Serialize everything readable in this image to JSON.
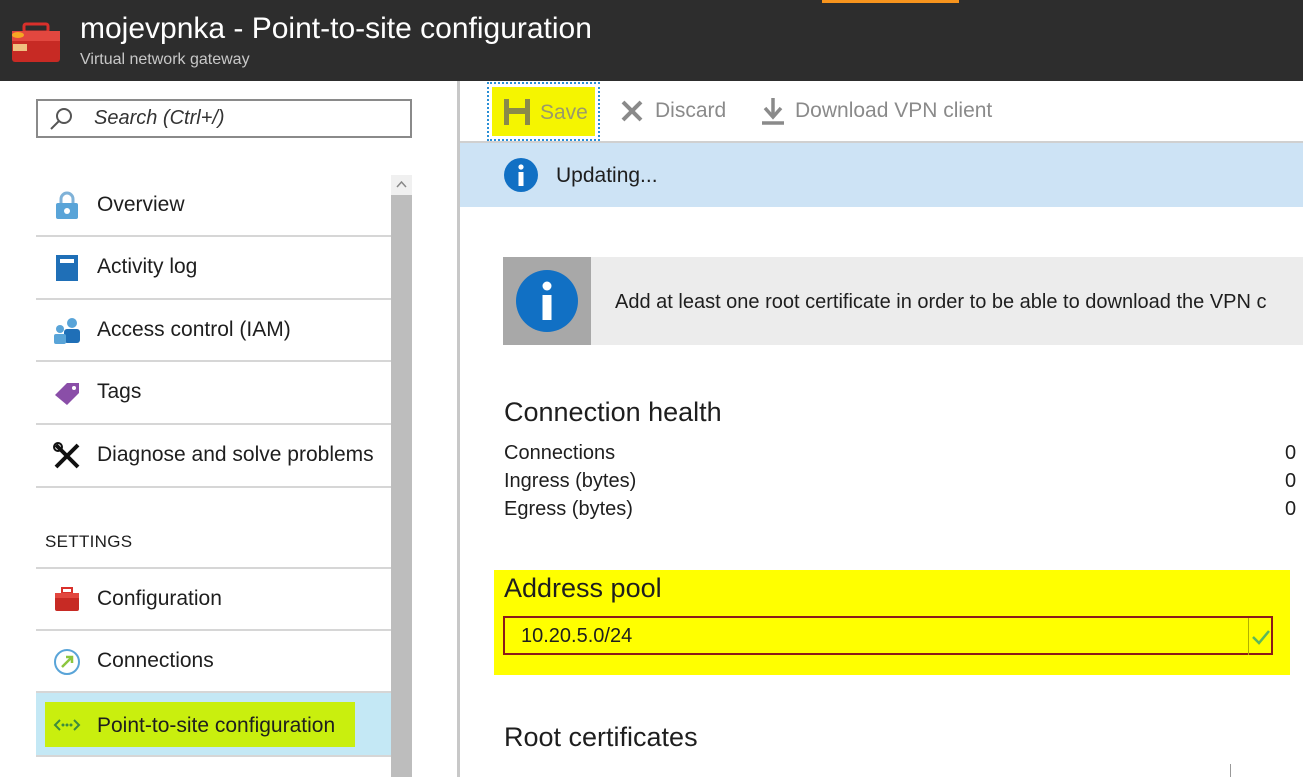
{
  "header": {
    "title": "mojevpnka - Point-to-site configuration",
    "subtitle": "Virtual network gateway",
    "accent_color": "#f7941d",
    "icon": "toolbox-icon"
  },
  "sidebar": {
    "search": {
      "placeholder": "Search (Ctrl+/)",
      "value": ""
    },
    "items": [
      {
        "label": "Overview",
        "icon": "overview-lock-icon"
      },
      {
        "label": "Activity log",
        "icon": "activity-log-icon"
      },
      {
        "label": "Access control (IAM)",
        "icon": "iam-users-icon"
      },
      {
        "label": "Tags",
        "icon": "tag-icon"
      },
      {
        "label": "Diagnose and solve problems",
        "icon": "tools-icon"
      }
    ],
    "settings_heading": "SETTINGS",
    "settings_items": [
      {
        "label": "Configuration",
        "icon": "toolbox-icon"
      },
      {
        "label": "Connections",
        "icon": "connections-icon"
      },
      {
        "label": "Point-to-site configuration",
        "icon": "point-to-site-icon",
        "selected": true
      }
    ]
  },
  "toolbar": {
    "save_label": "Save",
    "discard_label": "Discard",
    "download_label": "Download VPN client"
  },
  "status": {
    "text": "Updating...",
    "color": "#cde3f5"
  },
  "notice": {
    "text": "Add at least one root certificate in order to be able to download the VPN c"
  },
  "connection_health": {
    "heading": "Connection health",
    "rows": [
      {
        "label": "Connections",
        "value": "0"
      },
      {
        "label": "Ingress (bytes)",
        "value": "0"
      },
      {
        "label": "Egress (bytes)",
        "value": "0"
      }
    ]
  },
  "address_pool": {
    "heading": "Address pool",
    "value": "10.20.5.0/24",
    "highlight_color": "#ffff00"
  },
  "root_certificates": {
    "heading": "Root certificates"
  }
}
